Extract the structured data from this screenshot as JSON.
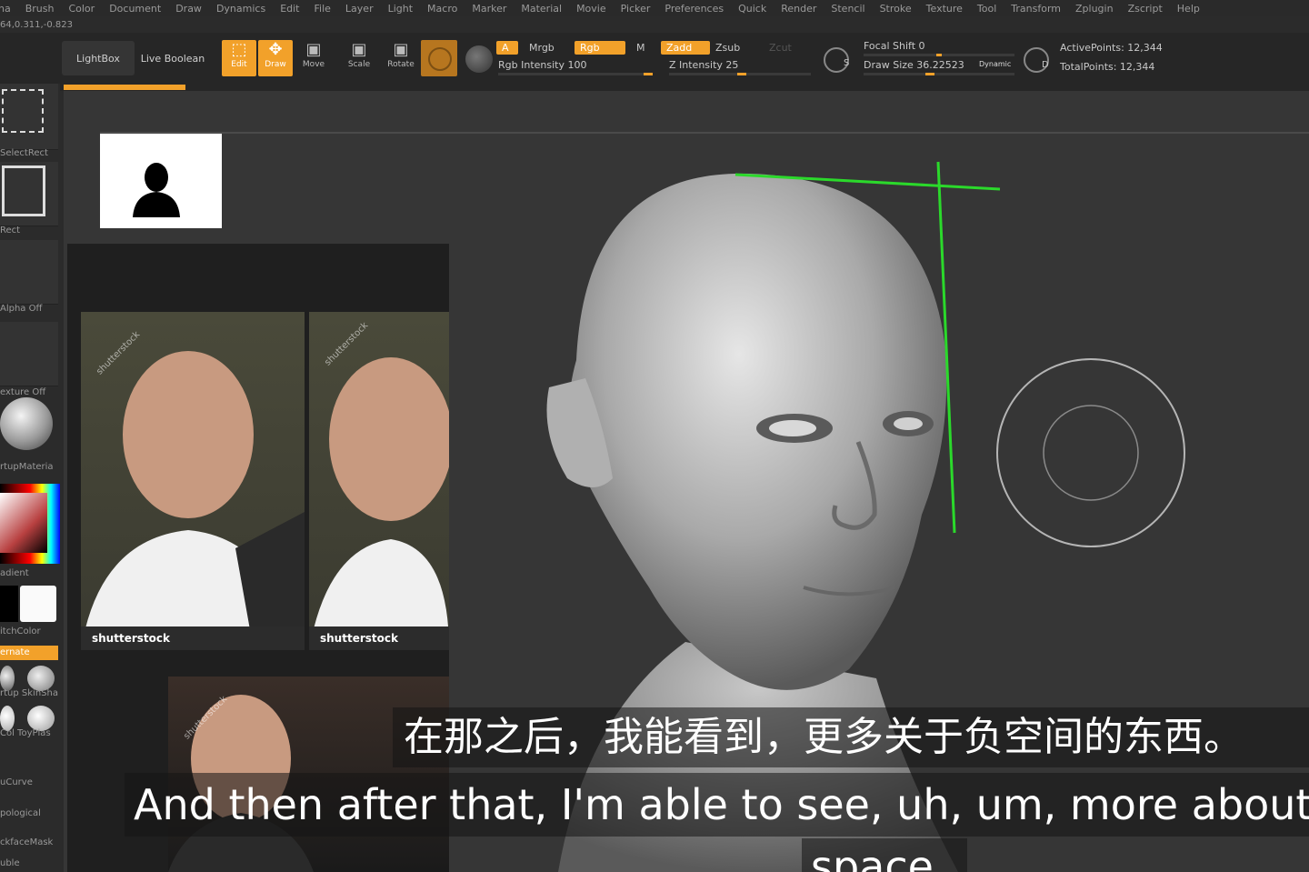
{
  "menu": [
    "ha",
    "Brush",
    "Color",
    "Document",
    "Draw",
    "Dynamics",
    "Edit",
    "File",
    "Layer",
    "Light",
    "Macro",
    "Marker",
    "Material",
    "Movie",
    "Picker",
    "Preferences",
    "Quick",
    "Render",
    "Stencil",
    "Stroke",
    "Texture",
    "Tool",
    "Transform",
    "Zplugin",
    "Zscript",
    "Help"
  ],
  "coords": "64,0.311,-0.823",
  "toolbar": {
    "lightbox": "LightBox",
    "liveboolean": "Live Boolean",
    "edit": "Edit",
    "draw": "Draw",
    "move": "Move",
    "scale": "Scale",
    "rotate": "Rotate",
    "a": "A",
    "mrgb": "Mrgb",
    "rgb": "Rgb",
    "m": "M",
    "rgb_intensity": "Rgb Intensity 100",
    "zadd": "Zadd",
    "zsub": "Zsub",
    "zcut": "Zcut",
    "z_intensity": "Z Intensity 25",
    "focal_shift": "Focal Shift 0",
    "draw_size": "Draw Size 36.22523",
    "dynamic": "Dynamic",
    "active_points": "ActivePoints: 12,344",
    "total_points": "TotalPoints: 12,344",
    "s_label": "S",
    "d_label": "D",
    "rgb_intensity_value": 100,
    "z_intensity_value": 25
  },
  "left": {
    "selectrect": "SelectRect",
    "rect": "Rect",
    "alpha_off": "Alpha Off",
    "texture_off": "exture Off",
    "material": "rtupMateria",
    "gradient": "adient",
    "switchcolor": "itchColor",
    "alternate": "ernate",
    "startup_skin": "rtup SkinSha",
    "toyplastic": "Col ToyPlas",
    "curve": "uCurve",
    "topological": "pological",
    "backfacemask": "ckfaceMask",
    "double": "uble"
  },
  "reference": {
    "brand1": "shutterstock",
    "brand2": "shutterstock",
    "watermark": "shutterstock"
  },
  "subtitles": {
    "cn": "在那之后，我能看到，更多关于负空间的东西。",
    "en": "And then after that, I'm able to see, uh, um, more about negative",
    "en2": "space."
  },
  "colors": {
    "accent": "#f2a12a",
    "guide": "#2bd92b"
  }
}
